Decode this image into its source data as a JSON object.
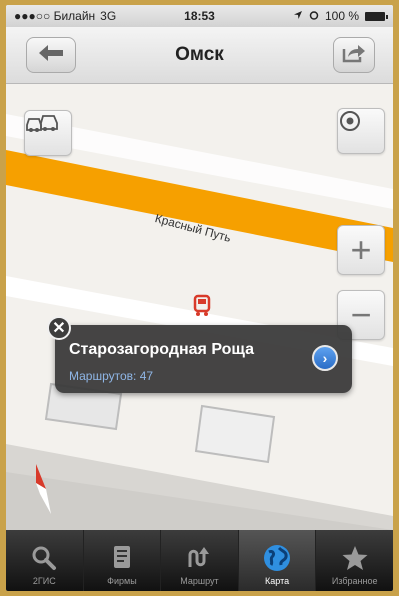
{
  "status_bar": {
    "carrier": "●●●○○ Билайн",
    "network": "3G",
    "time": "18:53",
    "battery_text": "100 %"
  },
  "nav": {
    "title": "Омск",
    "back_icon": "back-arrow-icon",
    "share_icon": "share-icon"
  },
  "map": {
    "street_label": "Красный Путь",
    "traffic_icon": "cars-icon",
    "locate_icon": "locate-icon",
    "zoom_in_label": "+",
    "zoom_out_label": "−",
    "colors": {
      "road": "#f6a000",
      "background": "#f3f1ed",
      "pin": "#d83a2a"
    }
  },
  "callout": {
    "title": "Старозагородная Роща",
    "subtitle": "Маршрутов: 47",
    "close_label": "✕",
    "go_label": "›"
  },
  "tabbar": {
    "items": [
      {
        "label": "2ГИС",
        "icon": "search-icon"
      },
      {
        "label": "Фирмы",
        "icon": "document-icon"
      },
      {
        "label": "Маршрут",
        "icon": "route-icon"
      },
      {
        "label": "Карта",
        "icon": "globe-icon",
        "active": true
      },
      {
        "label": "Избранное",
        "icon": "star-icon"
      }
    ]
  }
}
